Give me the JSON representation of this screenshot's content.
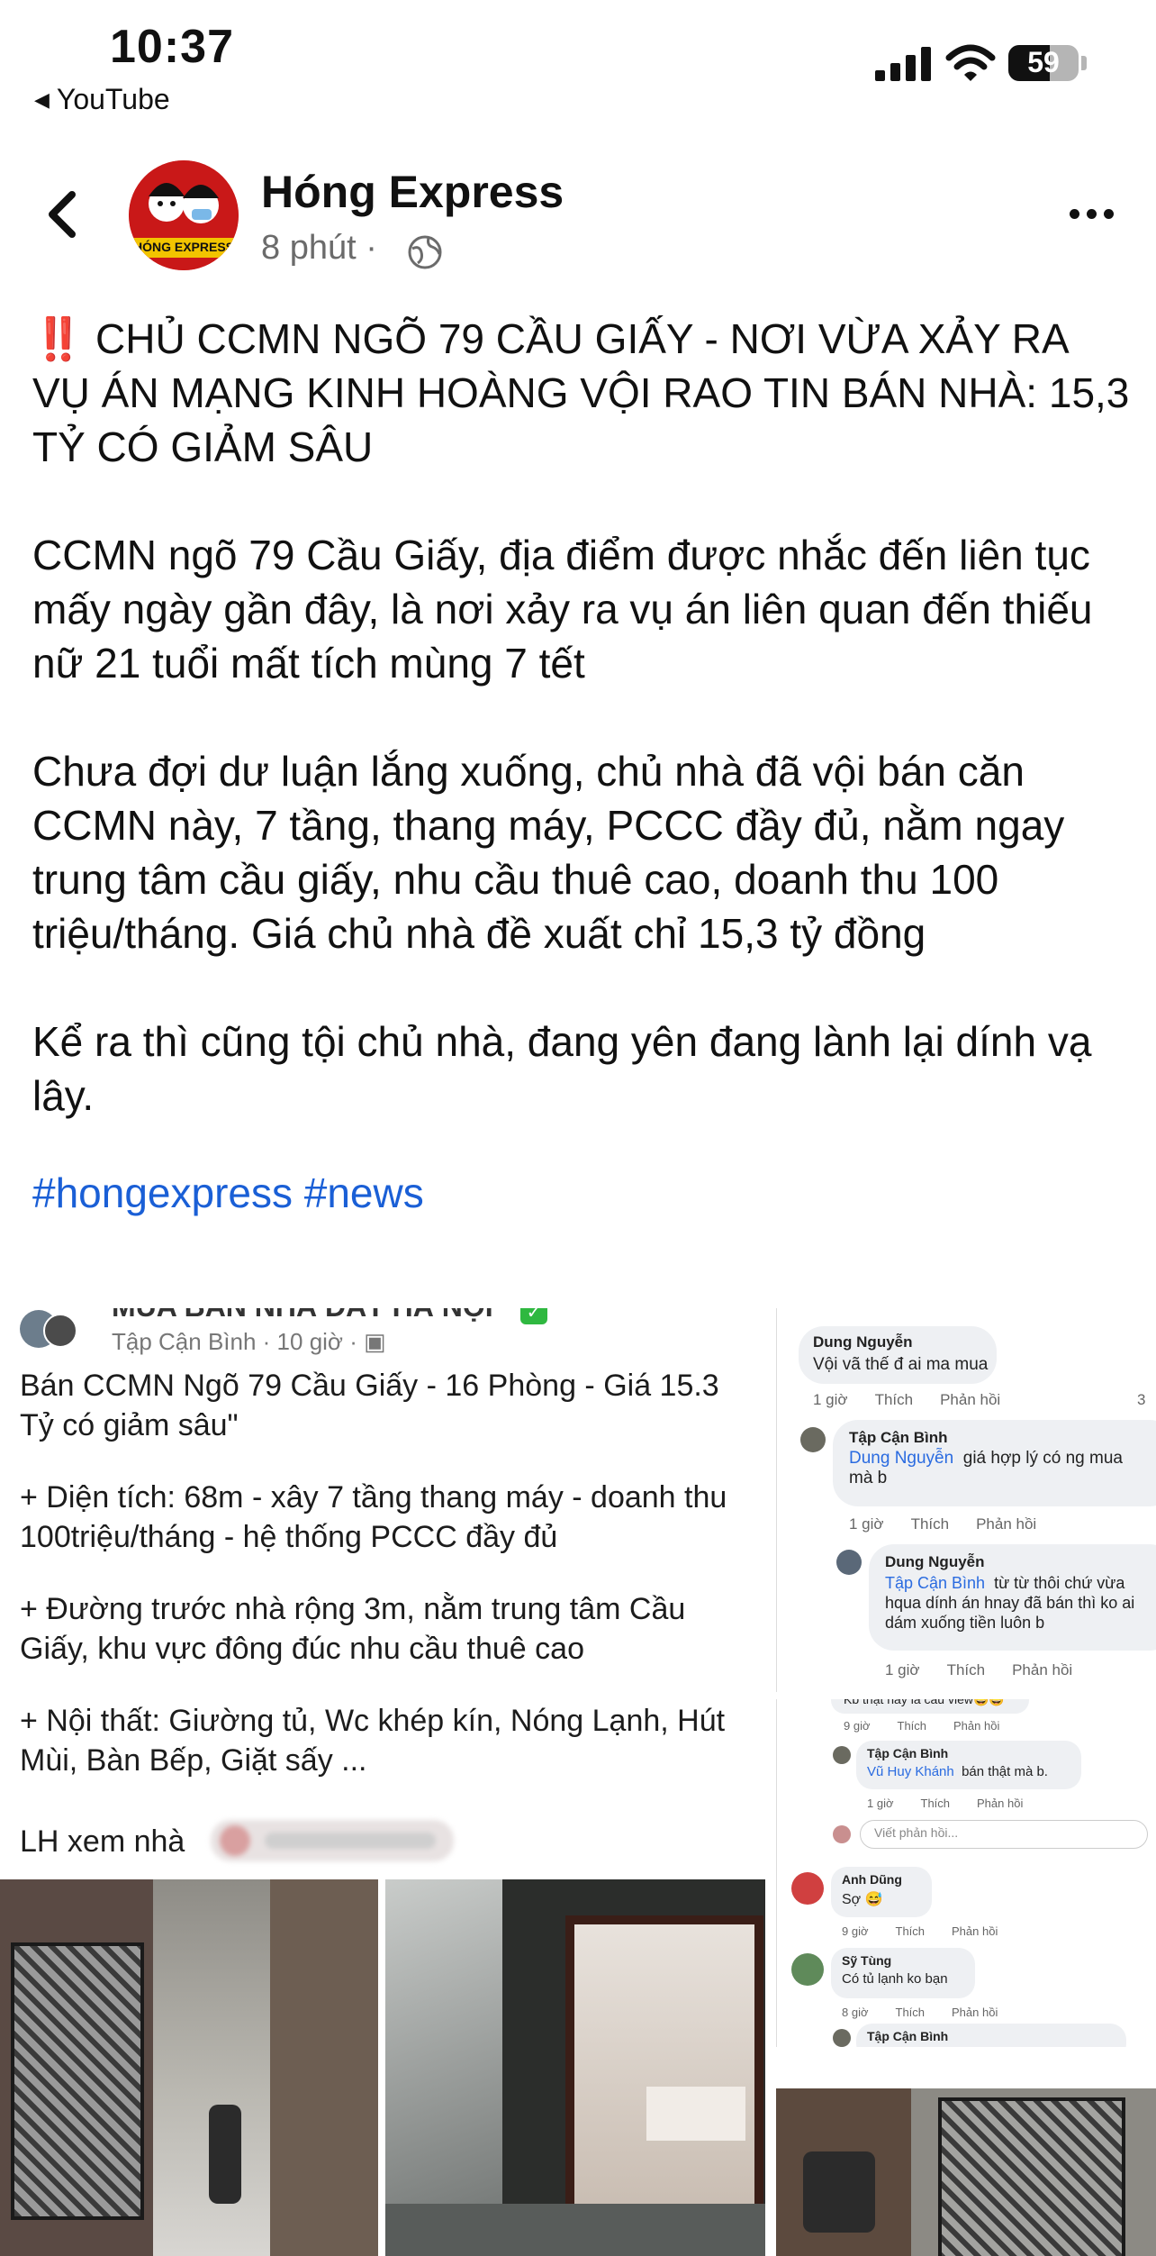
{
  "status_bar": {
    "time": "10:37",
    "back_app": "YouTube",
    "battery": "59"
  },
  "header": {
    "page_name": "Hóng Express",
    "post_time": "8 phút ·",
    "avatar_text": "HÓNG EXPRESS"
  },
  "post": {
    "p1": "‼️ CHỦ CCMN NGÕ 79 CẦU GIẤY - NƠI VỪA XẢY RA VỤ ÁN MẠNG KINH HOÀNG VỘI RAO TIN BÁN NHÀ: 15,3 TỶ CÓ GIẢM SÂU",
    "p2": "CCMN ngõ 79 Cầu Giấy, địa điểm được nhắc đến liên tục mấy ngày gần đây, là nơi xảy ra vụ án liên quan đến thiếu nữ 21 tuổi mất tích mùng 7 tết",
    "p3": "Chưa đợi dư luận lắng xuống, chủ nhà đã vội bán căn CCMN này, 7 tầng, thang máy, PCCC đầy đủ, nằm ngay trung tâm cầu giấy, nhu cầu thuê cao, doanh thu 100 triệu/tháng. Giá chủ nhà đề xuất chỉ 15,3 tỷ đồng",
    "p4": "Kể ra thì cũng tội chủ nhà, đang yên đang lành lại dính vạ lây.",
    "hashtags": "#hongexpress #news"
  },
  "shared_post": {
    "group_name": "MUA BÁN NHÀ ĐẤT HÀ NỘI",
    "author": "Tập Cận Bình",
    "time": "· 10 giờ ·",
    "title": "Bán CCMN Ngõ 79 Cầu Giấy - 16 Phòng - Giá 15.3 Tỷ có giảm sâu\"",
    "line1": "+ Diện tích: 68m - xây 7 tầng thang máy - doanh thu 100triệu/tháng - hệ thống PCCC đầy đủ",
    "line2": "+ Đường trước nhà rộng 3m, nằm trung tâm Cầu Giấy, khu vực đông đúc nhu cầu thuê cao",
    "line3": "+ Nội thất: Giường tủ, Wc khép kín, Nóng Lạnh, Hút Mùi, Bàn Bếp, Giặt sấy ...",
    "contact": "LH xem nhà"
  },
  "comments_top": {
    "c1_name": "Dung Nguyễn",
    "c1_text": "Vội vã thế đ ai ma mua",
    "c1_time": "1 giờ",
    "c1_count": "3",
    "c2_name": "Tập Cận Bình",
    "c2_mention": "Dung Nguyễn",
    "c2_text": "giá hợp lý có ng mua mà b",
    "c2_time": "1 giờ",
    "c3_name": "Dung Nguyễn",
    "c3_mention": "Tập Cận Bình",
    "c3_text": "từ từ thôi chứ vừa hqua dính án hnay đã bán thì ko ai dám xuống tiền luôn b",
    "c3_time": "1 giờ",
    "like": "Thích",
    "reply": "Phản hồi"
  },
  "comments_bottom": {
    "c0_text": "Kb thật hay là câu view😅😅",
    "c0_time": "9 giờ",
    "c1_name": "Tập Cận Bình",
    "c1_mention": "Vũ Huy Khánh",
    "c1_text": "bán thật mà b.",
    "c1_time": "1 giờ",
    "reply_placeholder": "Viết phản hồi...",
    "c2_name": "Anh Dũng",
    "c2_text": "Sợ 😅",
    "c2_time": "9 giờ",
    "c3_name": "Sỹ Tùng",
    "c3_text": "Có tủ lạnh ko bạn",
    "c3_time": "8 giờ",
    "c4_name": "Tập Cận Bình"
  }
}
